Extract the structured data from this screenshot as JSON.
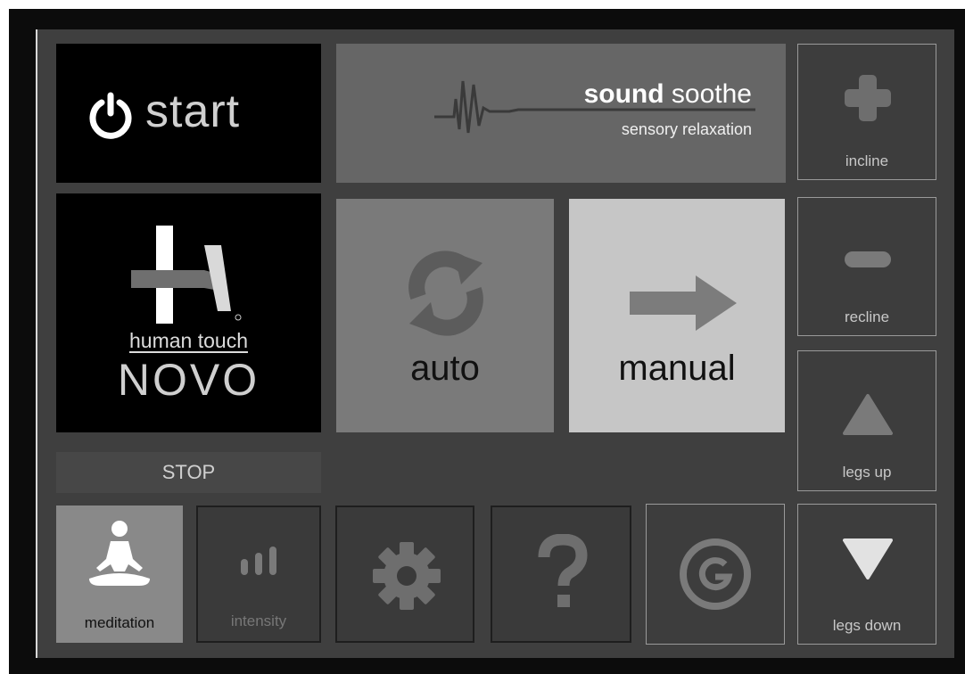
{
  "start": {
    "label": "start"
  },
  "sound": {
    "bold": "sound",
    "normal": "soothe",
    "subtitle": "sensory relaxation"
  },
  "side": {
    "incline": "incline",
    "recline": "recline",
    "legs_up": "legs up",
    "legs_down": "legs down"
  },
  "brand": {
    "name": "human touch",
    "model": "NOVO"
  },
  "modes": {
    "auto": "auto",
    "manual": "manual"
  },
  "stop": {
    "label": "STOP"
  },
  "bottom": {
    "meditation": "meditation",
    "intensity": "intensity"
  },
  "colors": {
    "screen_bg": "#3f3f3f",
    "frame": "#0c0c0c",
    "auto_bg": "#7a7a7a",
    "manual_bg": "#c6c6c6",
    "meditation_bg": "#898989",
    "sound_bg": "#666666"
  }
}
